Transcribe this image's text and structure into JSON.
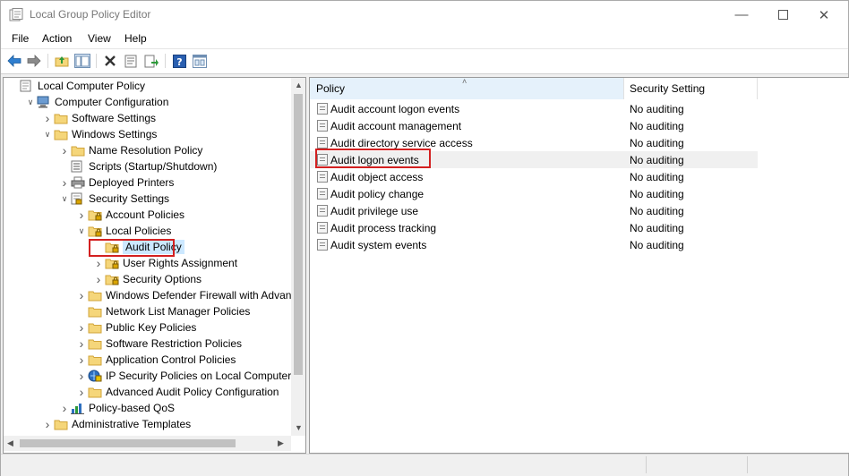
{
  "window": {
    "title": "Local Group Policy Editor"
  },
  "menu": [
    "File",
    "Action",
    "View",
    "Help"
  ],
  "toolbar": [
    "back-icon",
    "forward-icon",
    "up-folder-icon",
    "show-hide-tree-icon",
    "delete-icon",
    "properties-icon",
    "export-list-icon",
    "help-icon",
    "console-view-icon"
  ],
  "tree": {
    "nodes": [
      {
        "label": "Local Computer Policy",
        "depth": 0,
        "expander": "",
        "icon": "policy-doc-icon"
      },
      {
        "label": "Computer Configuration",
        "depth": 1,
        "expander": "open",
        "icon": "computer-icon"
      },
      {
        "label": "Software Settings",
        "depth": 2,
        "expander": "closed",
        "icon": "folder-icon"
      },
      {
        "label": "Windows Settings",
        "depth": 2,
        "expander": "open",
        "icon": "folder-icon"
      },
      {
        "label": "Name Resolution Policy",
        "depth": 3,
        "expander": "closed",
        "icon": "folder-icon"
      },
      {
        "label": "Scripts (Startup/Shutdown)",
        "depth": 3,
        "expander": "",
        "icon": "script-icon"
      },
      {
        "label": "Deployed Printers",
        "depth": 3,
        "expander": "closed",
        "icon": "printer-icon"
      },
      {
        "label": "Security Settings",
        "depth": 3,
        "expander": "open",
        "icon": "security-icon"
      },
      {
        "label": "Account Policies",
        "depth": 4,
        "expander": "closed",
        "icon": "locked-folder-icon"
      },
      {
        "label": "Local Policies",
        "depth": 4,
        "expander": "open",
        "icon": "locked-folder-icon"
      },
      {
        "label": "Audit Policy",
        "depth": 5,
        "expander": "",
        "icon": "locked-folder-icon",
        "selected": true
      },
      {
        "label": "User Rights Assignment",
        "depth": 5,
        "expander": "closed",
        "icon": "locked-folder-icon"
      },
      {
        "label": "Security Options",
        "depth": 5,
        "expander": "closed",
        "icon": "locked-folder-icon"
      },
      {
        "label": "Windows Defender Firewall with Advance",
        "depth": 4,
        "expander": "closed",
        "icon": "folder-icon"
      },
      {
        "label": "Network List Manager Policies",
        "depth": 4,
        "expander": "",
        "icon": "folder-icon"
      },
      {
        "label": "Public Key Policies",
        "depth": 4,
        "expander": "closed",
        "icon": "folder-icon"
      },
      {
        "label": "Software Restriction Policies",
        "depth": 4,
        "expander": "closed",
        "icon": "folder-icon"
      },
      {
        "label": "Application Control Policies",
        "depth": 4,
        "expander": "closed",
        "icon": "folder-icon"
      },
      {
        "label": "IP Security Policies on Local Computer",
        "depth": 4,
        "expander": "closed",
        "icon": "ip-security-icon"
      },
      {
        "label": "Advanced Audit Policy Configuration",
        "depth": 4,
        "expander": "closed",
        "icon": "folder-icon"
      },
      {
        "label": "Policy-based QoS",
        "depth": 3,
        "expander": "closed",
        "icon": "qos-chart-icon"
      },
      {
        "label": "Administrative Templates",
        "depth": 2,
        "expander": "closed",
        "icon": "folder-icon"
      }
    ]
  },
  "list": {
    "columns": [
      "Policy",
      "Security Setting"
    ],
    "rows": [
      {
        "policy": "Audit account logon events",
        "setting": "No auditing"
      },
      {
        "policy": "Audit account management",
        "setting": "No auditing"
      },
      {
        "policy": "Audit directory service access",
        "setting": "No auditing"
      },
      {
        "policy": "Audit logon events",
        "setting": "No auditing",
        "highlighted": true
      },
      {
        "policy": "Audit object access",
        "setting": "No auditing"
      },
      {
        "policy": "Audit policy change",
        "setting": "No auditing"
      },
      {
        "policy": "Audit privilege use",
        "setting": "No auditing"
      },
      {
        "policy": "Audit process tracking",
        "setting": "No auditing"
      },
      {
        "policy": "Audit system events",
        "setting": "No auditing"
      }
    ]
  },
  "colors": {
    "highlight_border": "#d32020",
    "column_header_bg": "#e5f1fb",
    "selected_row_bg": "#f0f0f0"
  }
}
